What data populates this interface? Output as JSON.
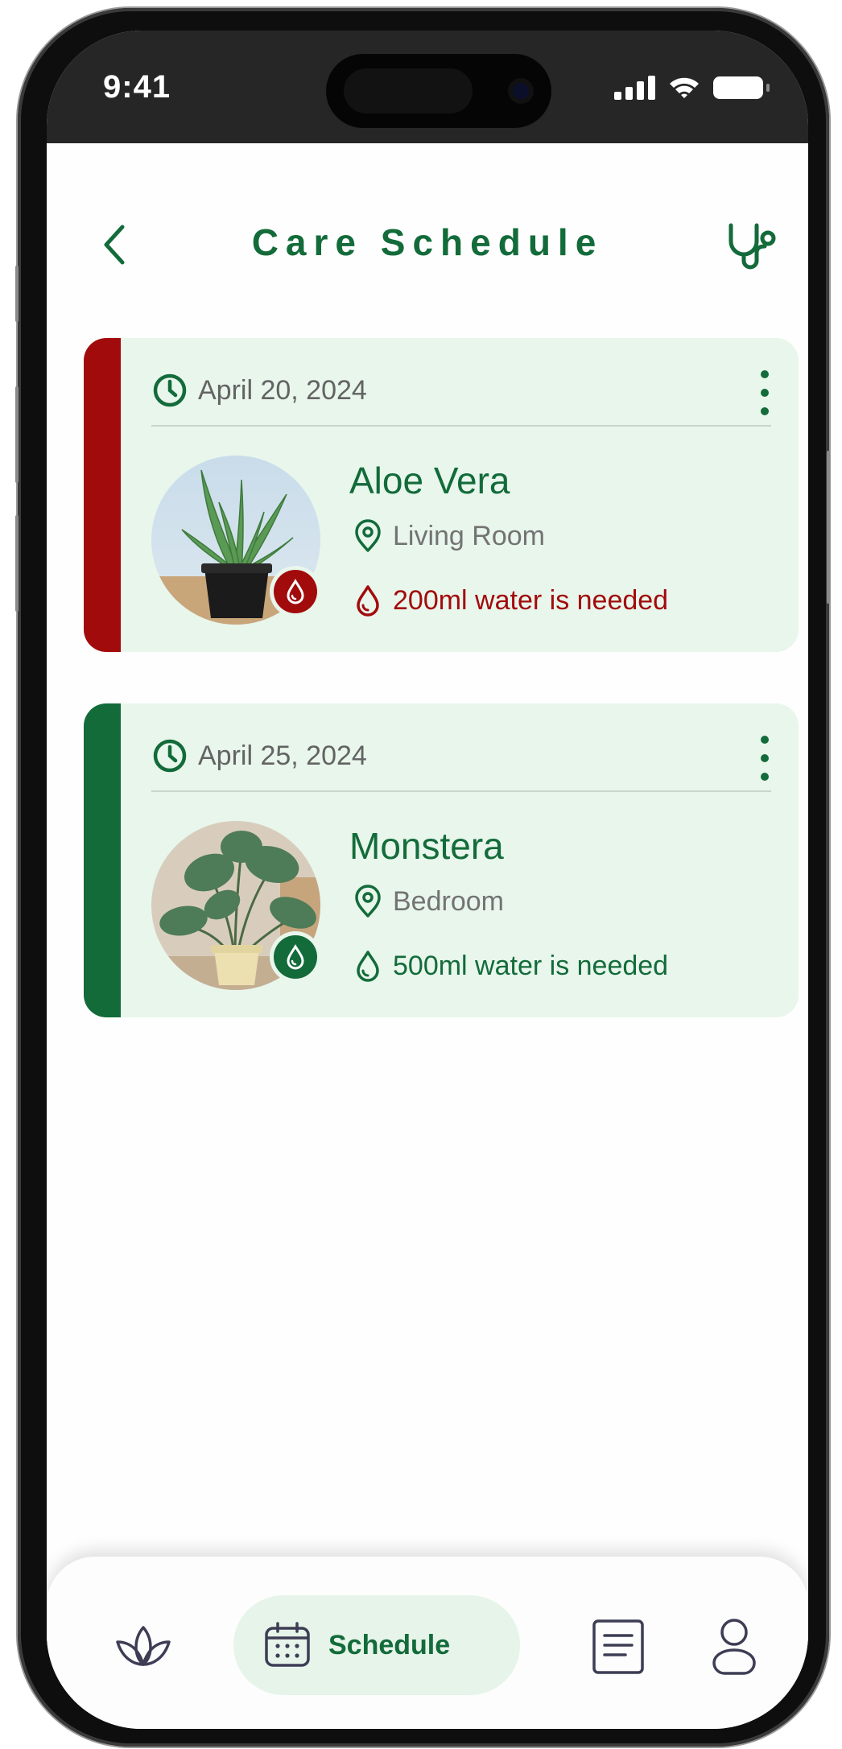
{
  "status_bar": {
    "time": "9:41"
  },
  "header": {
    "title": "Care Schedule",
    "back_icon": "chevron-left-icon",
    "action_icon": "stethoscope-icon"
  },
  "colors": {
    "primary": "#136b3a",
    "urgent": "#a20b0b",
    "card_background": "#e8f6ec",
    "nav_active_background": "#e6f4e9"
  },
  "schedule": [
    {
      "date": "April 20, 2024",
      "plant": "Aloe Vera",
      "location": "Living Room",
      "water": "200ml water is needed",
      "status": "urgent",
      "accent": "#a20b0b",
      "photo_icon": "aloe-vera-photo"
    },
    {
      "date": "April 25, 2024",
      "plant": "Monstera",
      "location": "Bedroom",
      "water": "500ml water is needed",
      "status": "upcoming",
      "accent": "#136b3a",
      "photo_icon": "monstera-photo"
    }
  ],
  "bottom_nav": {
    "items": [
      {
        "icon": "lotus-icon",
        "label": "",
        "active": false
      },
      {
        "icon": "calendar-icon",
        "label": "Schedule",
        "active": true
      },
      {
        "icon": "document-icon",
        "label": "",
        "active": false
      },
      {
        "icon": "user-icon",
        "label": "",
        "active": false
      }
    ]
  }
}
